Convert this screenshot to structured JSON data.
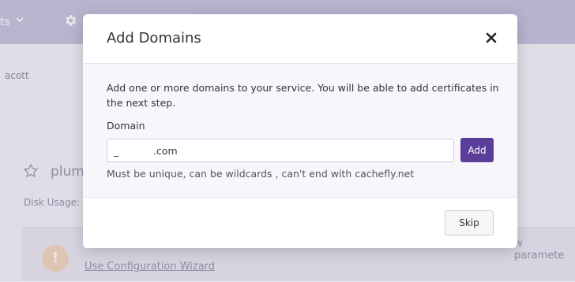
{
  "background": {
    "nav_fragment": "ts",
    "account_fragment": "acott",
    "service_fragment": "plumc",
    "disk_usage_fragment": "Disk Usage:",
    "wizard_link": "Use Configuration Wizard",
    "params_fragment": "w paramete",
    "warning_icon_glyph": "!",
    "icons": [
      "chevron-down-icon",
      "gear-icon",
      "star-icon",
      "warning-icon"
    ]
  },
  "modal": {
    "title": "Add Domains",
    "close_icon": "close-icon",
    "description": "Add one or more domains to your service. You will be able to add certificates in the next step.",
    "domain_label": "Domain",
    "domain_input_value": "_           .com",
    "add_button_label": "Add",
    "hint": "Must be unique, can be wildcards , can't end with cachefly.net",
    "skip_button_label": "Skip"
  },
  "colors": {
    "accent": "#5a3e9a",
    "topbar": "#cbc6df"
  }
}
